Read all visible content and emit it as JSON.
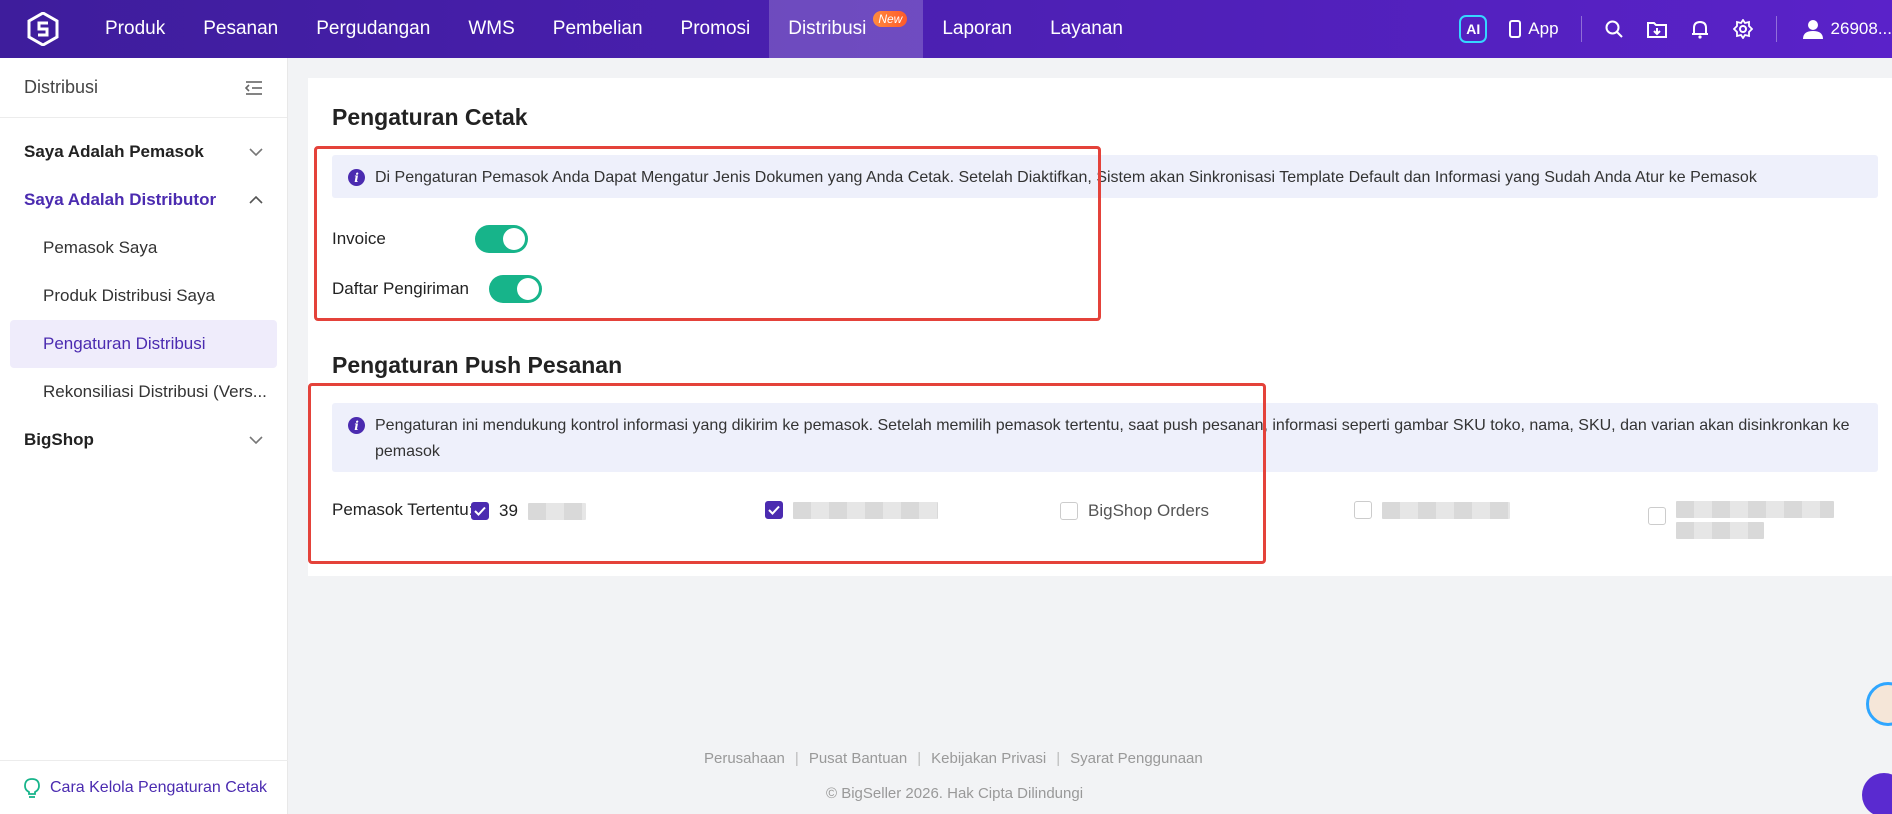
{
  "nav": {
    "items": [
      "Produk",
      "Pesanan",
      "Pergudangan",
      "WMS",
      "Pembelian",
      "Promosi",
      "Distribusi",
      "Laporan",
      "Layanan"
    ],
    "active_index": 6,
    "badge": "New",
    "ai_label": "AI",
    "app_label": "App",
    "user_label": "26908..."
  },
  "sidebar": {
    "title": "Distribusi",
    "group_supplier": "Saya Adalah Pemasok",
    "group_distributor": "Saya Adalah Distributor",
    "item_my_suppliers": "Pemasok Saya",
    "item_my_products": "Produk Distribusi Saya",
    "item_settings": "Pengaturan Distribusi",
    "item_reconcile": "Rekonsiliasi Distribusi (Vers...",
    "group_bigshop": "BigShop",
    "help_link": "Cara Kelola Pengaturan Cetak"
  },
  "print_settings": {
    "title": "Pengaturan Cetak",
    "info": "Di Pengaturan Pemasok Anda Dapat Mengatur Jenis Dokumen yang Anda Cetak. Setelah Diaktifkan, Sistem akan Sinkronisasi Template Default dan Informasi yang Sudah Anda Atur ke Pemasok",
    "invoice_label": "Invoice",
    "invoice_on": true,
    "shipping_label": "Daftar Pengiriman",
    "shipping_on": true
  },
  "push_settings": {
    "title": "Pengaturan Push Pesanan",
    "info": "Pengaturan ini mendukung kontrol informasi yang dikirim ke pemasok. Setelah memilih pemasok tertentu, saat push pesanan, informasi seperti gambar SKU toko, nama, SKU, dan varian akan disinkronkan ke pemasok",
    "supplier_label": "Pemasok Tertentu:",
    "supplier_1_prefix": "39",
    "supplier_3": "BigShop Orders"
  },
  "footer": {
    "links": [
      "Perusahaan",
      "Pusat Bantuan",
      "Kebijakan Privasi",
      "Syarat Penggunaan"
    ],
    "copyright": "© BigSeller 2026. Hak Cipta Dilindungi"
  },
  "colors": {
    "primary": "#4b2bb0",
    "toggle_on": "#17b48a",
    "highlight_box": "#e4423a"
  }
}
